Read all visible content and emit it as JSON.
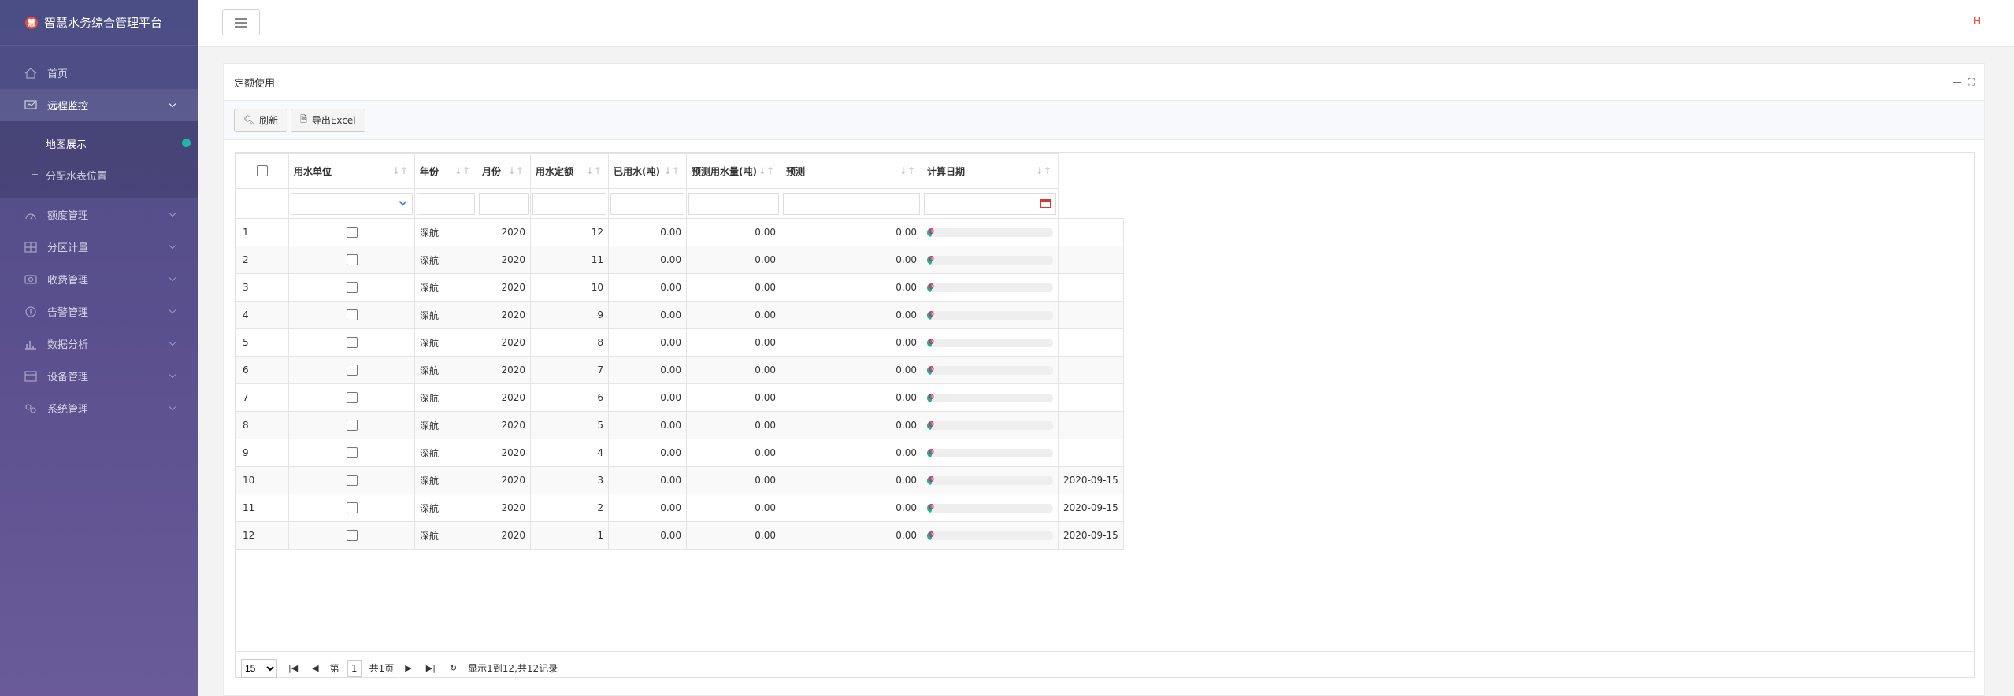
{
  "app": {
    "title": "智慧水务综合管理平台",
    "logo_text": "慧"
  },
  "sidebar": {
    "items": [
      {
        "label": "首页",
        "icon": "home-icon"
      },
      {
        "label": "远程监控",
        "icon": "monitor-icon"
      },
      {
        "label": "额度管理",
        "icon": "dashboard-icon"
      },
      {
        "label": "分区计量",
        "icon": "grid-icon"
      },
      {
        "label": "收费管理",
        "icon": "money-icon"
      },
      {
        "label": "告警管理",
        "icon": "alert-icon"
      },
      {
        "label": "数据分析",
        "icon": "chart-icon"
      },
      {
        "label": "设备管理",
        "icon": "device-icon"
      },
      {
        "label": "系统管理",
        "icon": "settings-icon"
      }
    ],
    "subitems": [
      {
        "label": "地图展示"
      },
      {
        "label": "分配水表位置"
      }
    ]
  },
  "topbar": {
    "user_icon": "H"
  },
  "panel": {
    "title": "定额使用",
    "tools": {
      "minimize": "—",
      "fullscreen": "⛶"
    }
  },
  "toolbar": {
    "refresh_label": "刷新",
    "export_label": "导出Excel"
  },
  "table": {
    "columns": [
      "用水单位",
      "年份",
      "月份",
      "用水定额",
      "已用水(吨)",
      "预测用水量(吨)",
      "预测",
      "计算日期"
    ],
    "progress_label": "0",
    "rows": [
      {
        "idx": "1",
        "unit": "深航",
        "year": "2020",
        "month": "12",
        "quota": "0.00",
        "used": "0.00",
        "pred": "0.00",
        "pct": 0.02,
        "date": ""
      },
      {
        "idx": "2",
        "unit": "深航",
        "year": "2020",
        "month": "11",
        "quota": "0.00",
        "used": "0.00",
        "pred": "0.00",
        "pct": 0.02,
        "date": ""
      },
      {
        "idx": "3",
        "unit": "深航",
        "year": "2020",
        "month": "10",
        "quota": "0.00",
        "used": "0.00",
        "pred": "0.00",
        "pct": 0.02,
        "date": ""
      },
      {
        "idx": "4",
        "unit": "深航",
        "year": "2020",
        "month": "9",
        "quota": "0.00",
        "used": "0.00",
        "pred": "0.00",
        "pct": 0.02,
        "date": ""
      },
      {
        "idx": "5",
        "unit": "深航",
        "year": "2020",
        "month": "8",
        "quota": "0.00",
        "used": "0.00",
        "pred": "0.00",
        "pct": 0.02,
        "date": ""
      },
      {
        "idx": "6",
        "unit": "深航",
        "year": "2020",
        "month": "7",
        "quota": "0.00",
        "used": "0.00",
        "pred": "0.00",
        "pct": 0.02,
        "date": ""
      },
      {
        "idx": "7",
        "unit": "深航",
        "year": "2020",
        "month": "6",
        "quota": "0.00",
        "used": "0.00",
        "pred": "0.00",
        "pct": 0.02,
        "date": ""
      },
      {
        "idx": "8",
        "unit": "深航",
        "year": "2020",
        "month": "5",
        "quota": "0.00",
        "used": "0.00",
        "pred": "0.00",
        "pct": 0.02,
        "date": ""
      },
      {
        "idx": "9",
        "unit": "深航",
        "year": "2020",
        "month": "4",
        "quota": "0.00",
        "used": "0.00",
        "pred": "0.00",
        "pct": 0.02,
        "date": ""
      },
      {
        "idx": "10",
        "unit": "深航",
        "year": "2020",
        "month": "3",
        "quota": "0.00",
        "used": "0.00",
        "pred": "0.00",
        "pct": 0.02,
        "date": "2020-09-15"
      },
      {
        "idx": "11",
        "unit": "深航",
        "year": "2020",
        "month": "2",
        "quota": "0.00",
        "used": "0.00",
        "pred": "0.00",
        "pct": 0.02,
        "date": "2020-09-15"
      },
      {
        "idx": "12",
        "unit": "深航",
        "year": "2020",
        "month": "1",
        "quota": "0.00",
        "used": "0.00",
        "pred": "0.00",
        "pct": 0.02,
        "date": "2020-09-15"
      }
    ]
  },
  "pager": {
    "page_size": "15",
    "page_prefix": "第",
    "page_value": "1",
    "page_total": "共1页",
    "summary": "显示1到12,共12记录"
  },
  "colors": {
    "accent": "#1ab394",
    "sidebar": "#4a4e84",
    "logo": "#e84c3d"
  }
}
